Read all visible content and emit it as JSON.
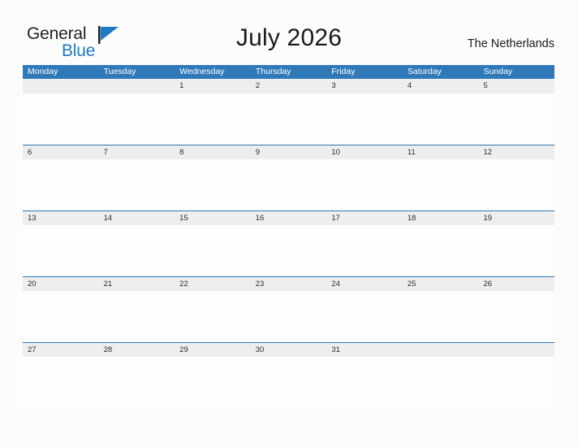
{
  "brand": {
    "name_part1": "General",
    "name_part2": "Blue",
    "flag_icon": "blue-triangle-flag-icon",
    "accent_color": "#1f7ac4"
  },
  "header": {
    "title": "July 2026",
    "country": "The Netherlands"
  },
  "colors": {
    "weekday_header_bg": "#3079b9",
    "week_band_bg": "#eeeeee",
    "week_band_border": "#2e75b6",
    "page_bg": "#fcfcfd",
    "text": "#1a1a1a"
  },
  "calendar": {
    "month": "July",
    "year": "2026",
    "weekdays": [
      "Monday",
      "Tuesday",
      "Wednesday",
      "Thursday",
      "Friday",
      "Saturday",
      "Sunday"
    ],
    "weeks": [
      [
        "",
        "",
        "1",
        "2",
        "3",
        "4",
        "5"
      ],
      [
        "6",
        "7",
        "8",
        "9",
        "10",
        "11",
        "12"
      ],
      [
        "13",
        "14",
        "15",
        "16",
        "17",
        "18",
        "19"
      ],
      [
        "20",
        "21",
        "22",
        "23",
        "24",
        "25",
        "26"
      ],
      [
        "27",
        "28",
        "29",
        "30",
        "31",
        "",
        ""
      ]
    ]
  }
}
